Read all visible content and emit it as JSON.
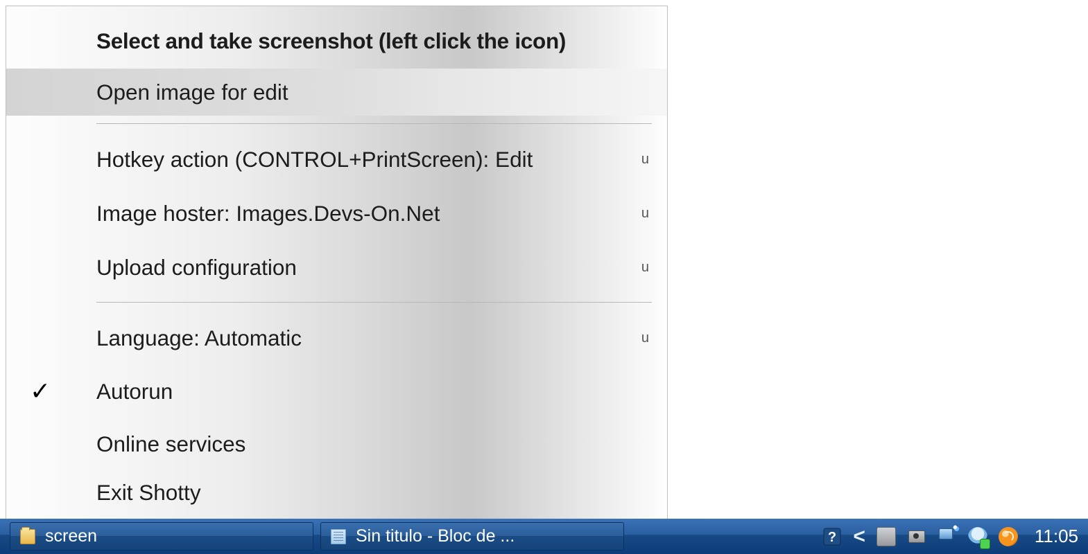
{
  "menu": {
    "title": "Select and take screenshot (left click the icon)",
    "open_image": "Open image for edit",
    "hotkey": "Hotkey action (CONTROL+PrintScreen): Edit",
    "hoster": "Image hoster: Images.Devs-On.Net",
    "upload": "Upload configuration",
    "language": "Language: Automatic",
    "autorun": "Autorun",
    "online": "Online services",
    "exit": "Exit Shotty",
    "submenu_glyph": "u"
  },
  "taskbar": {
    "screen_label": "screen",
    "notepad_label": "Sin titulo - Bloc de ...",
    "clock": "11:05"
  }
}
